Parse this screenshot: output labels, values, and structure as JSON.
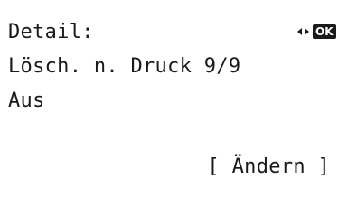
{
  "screen": {
    "title": "Detail:",
    "setting_label": "Lösch. n. Druck",
    "page_indicator": "9/9",
    "value": "Aus",
    "ok_label": "OK"
  },
  "softkeys": {
    "right_label": "[ Ändern ]"
  },
  "icons": {
    "left": "arrow-left-icon",
    "right": "arrow-right-icon",
    "ok": "ok-key-icon"
  }
}
